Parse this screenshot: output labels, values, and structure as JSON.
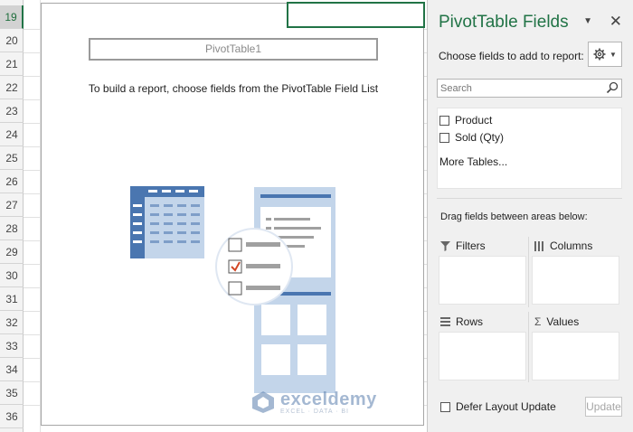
{
  "rows": [
    "19",
    "20",
    "21",
    "22",
    "23",
    "24",
    "25",
    "26",
    "27",
    "28",
    "29",
    "30",
    "31",
    "32",
    "33",
    "34",
    "35",
    "36"
  ],
  "selected_row": "19",
  "pivot": {
    "name": "PivotTable1",
    "message": "To build a report, choose fields from the PivotTable Field List"
  },
  "watermark": {
    "name": "exceldemy",
    "tagline": "EXCEL · DATA · BI"
  },
  "panel": {
    "title": "PivotTable Fields",
    "choose_label": "Choose fields to add to report:",
    "search_placeholder": "Search",
    "fields": [
      "Product",
      "Sold (Qty)"
    ],
    "more_tables": "More Tables...",
    "drag_text": "Drag fields between areas below:",
    "areas": {
      "filters": "Filters",
      "columns": "Columns",
      "rows": "Rows",
      "values": "Values"
    },
    "defer_label": "Defer Layout Update",
    "update_label": "Update"
  },
  "colors": {
    "accent": "#217346",
    "illustration_blue": "#4a76b0",
    "illustration_light": "#c3d5ea"
  }
}
